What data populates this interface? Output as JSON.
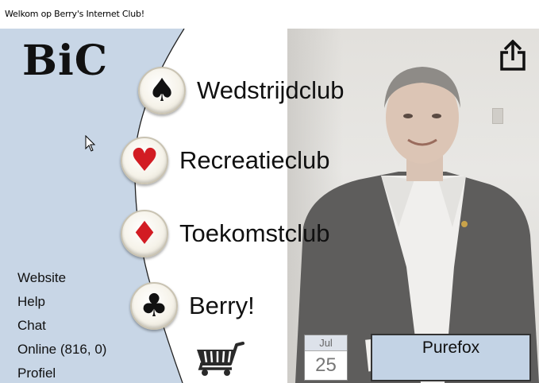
{
  "window": {
    "title": "Welkom op Berry's Internet Club!"
  },
  "logo": {
    "text": "BiC"
  },
  "menu": [
    {
      "label": "Wedstrijdclub",
      "icon": "spade-icon",
      "glyph": "♠",
      "color": "#111111"
    },
    {
      "label": "Recreatieclub",
      "icon": "heart-icon",
      "glyph": "♥",
      "color": "#d21c23"
    },
    {
      "label": "Toekomstclub",
      "icon": "diamond-icon",
      "glyph": "♦",
      "color": "#d21c23"
    },
    {
      "label": "Berry!",
      "icon": "club-icon",
      "glyph": "♣",
      "color": "#111111"
    }
  ],
  "side_links": [
    "Website",
    "Help",
    "Chat",
    "Online (816, 0)",
    "Profiel"
  ],
  "date": {
    "month": "Jul",
    "day": "25"
  },
  "user": {
    "name": "Purefox"
  },
  "colors": {
    "left_panel": "#c8d6e6",
    "user_box": "#c3d3e5",
    "suit_red": "#d21c23"
  }
}
